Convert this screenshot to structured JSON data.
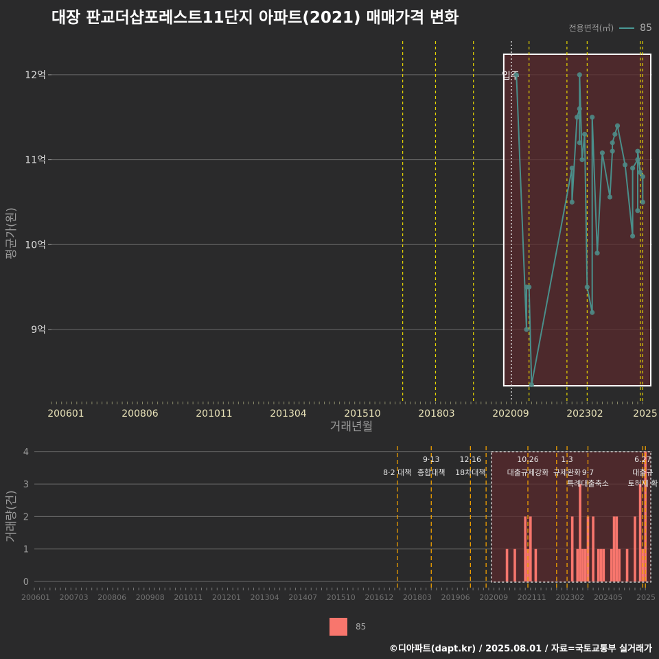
{
  "title": "대장 판교더샵포레스트11단지 아파트(2021) 매매가격 변화",
  "legend_top": {
    "title": "전용면적(㎡)",
    "value": "85"
  },
  "legend_bottom": {
    "value": "85"
  },
  "caption": "©디아파트(dapt.kr) / 2025.08.01 / 자료=국토교통부 실거래가",
  "colors": {
    "line": "#4a9a96",
    "bar": "#f8766d",
    "shade": "#5a2a2e",
    "vline": "#e8d800",
    "vline2": "#f0a000"
  },
  "chart_data": [
    {
      "type": "line",
      "xlabel": "거래년월",
      "ylabel": "평균가(원)",
      "x_tick_labels": [
        "200601",
        "200806",
        "201011",
        "201304",
        "201510",
        "201803",
        "202009",
        "202302",
        "2025"
      ],
      "y_ticks": [
        {
          "value": 9,
          "label": "9억"
        },
        {
          "value": 10,
          "label": "10억"
        },
        {
          "value": 11,
          "label": "11억"
        },
        {
          "value": 12,
          "label": "12억"
        }
      ],
      "ylim": [
        8.2,
        12.5
      ],
      "xlim": [
        "2006-01",
        "2025-08"
      ],
      "annotation": "입주",
      "move_in": "2021-03",
      "highlight_range": [
        "2020-12",
        "2025-07"
      ],
      "policy_lines": [
        "2017-08",
        "2018-09",
        "2019-12",
        "2021-10",
        "2023-01",
        "2023-09",
        "2025-06",
        "2025-07"
      ],
      "series": [
        {
          "name": "85",
          "points": [
            {
              "x": "2021-05",
              "y": 12.0
            },
            {
              "x": "2021-09",
              "y": 9.0
            },
            {
              "x": "2021-09",
              "y": 9.5
            },
            {
              "x": "2021-10",
              "y": 9.5
            },
            {
              "x": "2021-11",
              "y": 8.35
            },
            {
              "x": "2023-03",
              "y": 10.9
            },
            {
              "x": "2023-03",
              "y": 10.5
            },
            {
              "x": "2023-05",
              "y": 11.5
            },
            {
              "x": "2023-06",
              "y": 11.6
            },
            {
              "x": "2023-06",
              "y": 11.2
            },
            {
              "x": "2023-06",
              "y": 12.0
            },
            {
              "x": "2023-07",
              "y": 11.0
            },
            {
              "x": "2023-08",
              "y": 11.3
            },
            {
              "x": "2023-09",
              "y": 9.5
            },
            {
              "x": "2023-11",
              "y": 9.2
            },
            {
              "x": "2023-11",
              "y": 11.5
            },
            {
              "x": "2024-01",
              "y": 9.9
            },
            {
              "x": "2024-03",
              "y": 11.08
            },
            {
              "x": "2024-06",
              "y": 10.56
            },
            {
              "x": "2024-07",
              "y": 11.1
            },
            {
              "x": "2024-07",
              "y": 11.2
            },
            {
              "x": "2024-08",
              "y": 11.3
            },
            {
              "x": "2024-09",
              "y": 11.4
            },
            {
              "x": "2024-12",
              "y": 10.94
            },
            {
              "x": "2025-03",
              "y": 10.1
            },
            {
              "x": "2025-03",
              "y": 10.9
            },
            {
              "x": "2025-05",
              "y": 11.0
            },
            {
              "x": "2025-05",
              "y": 10.4
            },
            {
              "x": "2025-05",
              "y": 11.1
            },
            {
              "x": "2025-06",
              "y": 10.85
            },
            {
              "x": "2025-07",
              "y": 10.8
            },
            {
              "x": "2025-07",
              "y": 10.5
            }
          ]
        }
      ]
    },
    {
      "type": "bar",
      "ylabel": "거래량(건)",
      "x_tick_labels": [
        "200601",
        "200703",
        "200806",
        "200908",
        "201011",
        "201201",
        "201304",
        "201407",
        "201510",
        "201612",
        "201803",
        "201906",
        "202009",
        "202111",
        "202302",
        "202405",
        "2025"
      ],
      "y_ticks": [
        0,
        1,
        2,
        3,
        4
      ],
      "ylim": [
        0,
        4
      ],
      "xlim": [
        "2006-01",
        "2025-08"
      ],
      "highlight_range": [
        "2020-08",
        "2025-07"
      ],
      "policy_lines": [
        {
          "x": "2017-08",
          "date": "",
          "label": "8·2 대책",
          "label2": ""
        },
        {
          "x": "2018-09",
          "date": "9·13",
          "label": "종합대책",
          "label2": ""
        },
        {
          "x": "2019-12",
          "date": "12·16",
          "label": "18차대책",
          "label2": ""
        },
        {
          "x": "2020-06",
          "date": "",
          "label": "",
          "label2": ""
        },
        {
          "x": "2021-10",
          "date": "10.26",
          "label": "대출규제강화",
          "label2": ""
        },
        {
          "x": "2022-09",
          "date": "",
          "label": "",
          "label2": ""
        },
        {
          "x": "2023-01",
          "date": "1.3",
          "label": "규제완화",
          "label2": ""
        },
        {
          "x": "2023-09",
          "date": "",
          "label": "9·7",
          "label2": "특례대출축소"
        },
        {
          "x": "2025-06",
          "date": "6.27",
          "label": "대출규",
          "label2": "토허제 확"
        },
        {
          "x": "2025-07",
          "date": "",
          "label": "",
          "label2": ""
        }
      ],
      "bars": [
        {
          "x": "2021-02",
          "v": 1
        },
        {
          "x": "2021-05",
          "v": 1
        },
        {
          "x": "2021-09",
          "v": 2
        },
        {
          "x": "2021-10",
          "v": 1
        },
        {
          "x": "2021-11",
          "v": 2
        },
        {
          "x": "2022-01",
          "v": 1
        },
        {
          "x": "2023-03",
          "v": 2
        },
        {
          "x": "2023-05",
          "v": 1
        },
        {
          "x": "2023-06",
          "v": 3
        },
        {
          "x": "2023-07",
          "v": 1
        },
        {
          "x": "2023-08",
          "v": 1
        },
        {
          "x": "2023-09",
          "v": 2
        },
        {
          "x": "2023-11",
          "v": 2
        },
        {
          "x": "2024-01",
          "v": 1
        },
        {
          "x": "2024-02",
          "v": 1
        },
        {
          "x": "2024-03",
          "v": 1
        },
        {
          "x": "2024-06",
          "v": 1
        },
        {
          "x": "2024-07",
          "v": 2
        },
        {
          "x": "2024-08",
          "v": 2
        },
        {
          "x": "2024-09",
          "v": 1
        },
        {
          "x": "2024-12",
          "v": 1
        },
        {
          "x": "2025-03",
          "v": 2
        },
        {
          "x": "2025-05",
          "v": 3
        },
        {
          "x": "2025-06",
          "v": 1
        },
        {
          "x": "2025-07",
          "v": 4
        }
      ]
    }
  ]
}
